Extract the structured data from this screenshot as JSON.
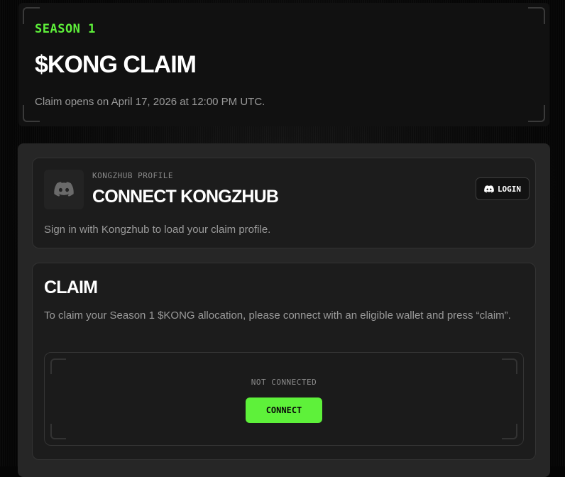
{
  "hero": {
    "season": "SEASON 1",
    "title": "$KONG CLAIM",
    "subtitle": "Claim opens on April 17, 2026 at 12:00 PM UTC."
  },
  "profile": {
    "kicker": "KONGZHUB PROFILE",
    "title": "CONNECT KONGZHUB",
    "login_label": "LOGIN",
    "login_icon": "discord-icon",
    "avatar_icon": "discord-icon",
    "description": "Sign in with Kongzhub to load your claim profile."
  },
  "claim": {
    "title": "CLAIM",
    "description": "To claim your Season 1 $KONG allocation, please connect with an eligible wallet and press “claim”.",
    "status": "NOT CONNECTED",
    "connect_label": "CONNECT"
  },
  "colors": {
    "accent": "#5ef13a",
    "background": "#050505",
    "panel": "#262626",
    "card": "#1c1c1c"
  }
}
